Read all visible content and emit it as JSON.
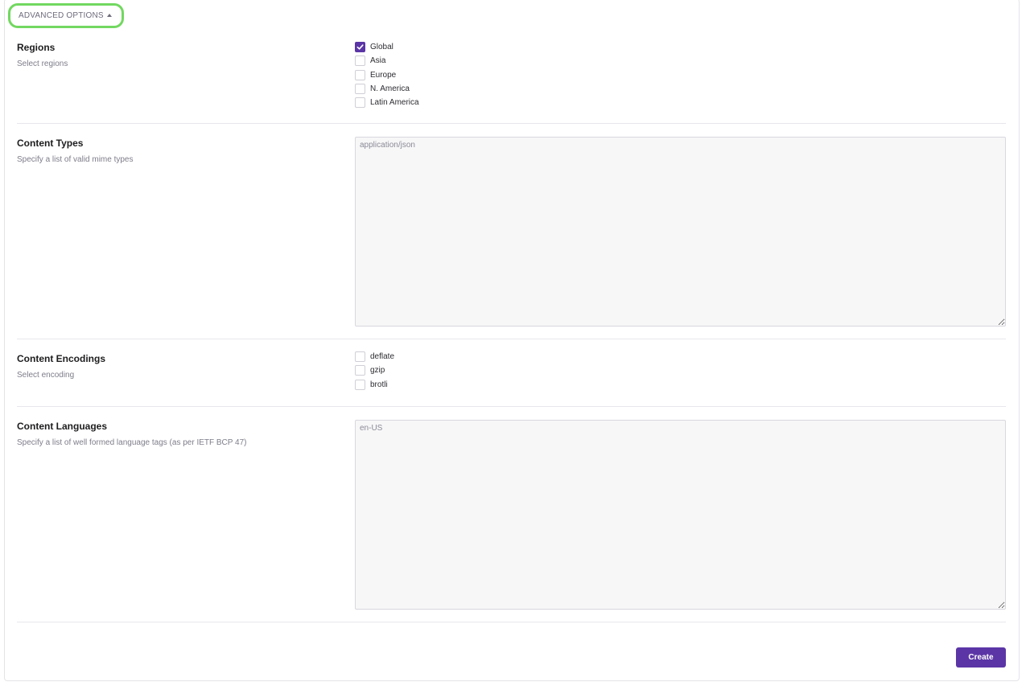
{
  "advanced_toggle": {
    "label": "ADVANCED OPTIONS"
  },
  "regions": {
    "title": "Regions",
    "description": "Select regions",
    "options": [
      {
        "label": "Global",
        "checked": true
      },
      {
        "label": "Asia",
        "checked": false
      },
      {
        "label": "Europe",
        "checked": false
      },
      {
        "label": "N. America",
        "checked": false
      },
      {
        "label": "Latin America",
        "checked": false
      }
    ]
  },
  "content_types": {
    "title": "Content Types",
    "description": "Specify a list of valid mime types",
    "placeholder": "application/json"
  },
  "content_encodings": {
    "title": "Content Encodings",
    "description": "Select encoding",
    "options": [
      {
        "label": "deflate",
        "checked": false
      },
      {
        "label": "gzip",
        "checked": false
      },
      {
        "label": "brotli",
        "checked": false
      }
    ]
  },
  "content_languages": {
    "title": "Content Languages",
    "description": "Specify a list of well formed language tags (as per IETF BCP 47)",
    "placeholder": "en-US"
  },
  "actions": {
    "create_label": "Create"
  },
  "colors": {
    "accent": "#5b35a6",
    "highlight": "#72d860",
    "textarea_bg": "#f7f7f8"
  }
}
